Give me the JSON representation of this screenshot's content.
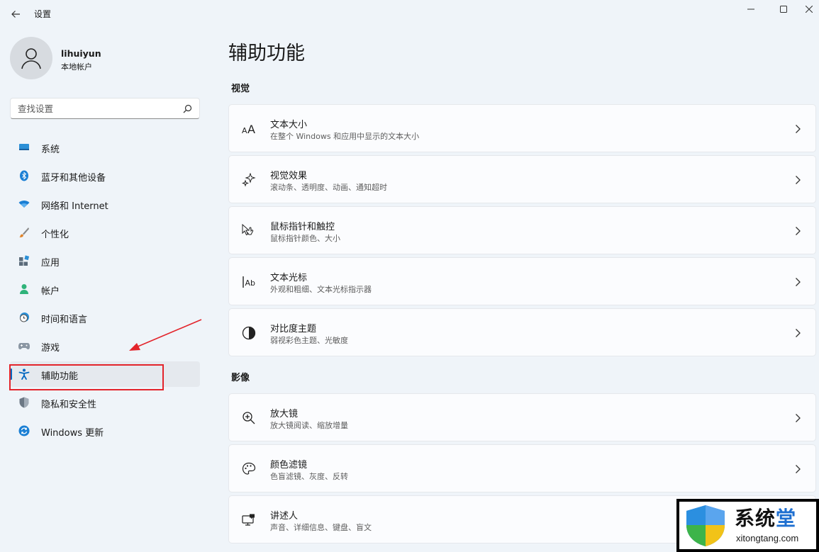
{
  "window": {
    "title": "设置",
    "back_icon": "back-arrow-icon",
    "controls": [
      "minimize-icon",
      "maximize-icon",
      "close-icon"
    ]
  },
  "user": {
    "name": "lihuiyun",
    "account_type": "本地帐户"
  },
  "search": {
    "placeholder": "查找设置",
    "value": ""
  },
  "sidebar": {
    "items": [
      {
        "label": "系统",
        "icon": "system-icon"
      },
      {
        "label": "蓝牙和其他设备",
        "icon": "bluetooth-icon"
      },
      {
        "label": "网络和 Internet",
        "icon": "wifi-icon"
      },
      {
        "label": "个性化",
        "icon": "brush-icon"
      },
      {
        "label": "应用",
        "icon": "apps-icon"
      },
      {
        "label": "帐户",
        "icon": "account-icon"
      },
      {
        "label": "时间和语言",
        "icon": "time-language-icon"
      },
      {
        "label": "游戏",
        "icon": "gamepad-icon"
      },
      {
        "label": "辅助功能",
        "icon": "accessibility-icon",
        "selected": true
      },
      {
        "label": "隐私和安全性",
        "icon": "shield-icon"
      },
      {
        "label": "Windows 更新",
        "icon": "update-icon"
      }
    ]
  },
  "main": {
    "title": "辅助功能",
    "sections": [
      {
        "title": "视觉",
        "cards": [
          {
            "title": "文本大小",
            "subtitle": "在整个 Windows 和应用中显示的文本大小",
            "icon": "text-size-icon"
          },
          {
            "title": "视觉效果",
            "subtitle": "滚动条、透明度、动画、通知超时",
            "icon": "sparkle-icon"
          },
          {
            "title": "鼠标指针和触控",
            "subtitle": "鼠标指针颜色、大小",
            "icon": "pointer-icon"
          },
          {
            "title": "文本光标",
            "subtitle": "外观和粗细、文本光标指示器",
            "icon": "text-cursor-icon"
          },
          {
            "title": "对比度主题",
            "subtitle": "弱视彩色主题、光敏度",
            "icon": "contrast-icon"
          }
        ]
      },
      {
        "title": "影像",
        "cards": [
          {
            "title": "放大镜",
            "subtitle": "放大镜阅读、缩放增量",
            "icon": "magnifier-icon"
          },
          {
            "title": "颜色滤镜",
            "subtitle": "色盲滤镜、灰度、反转",
            "icon": "palette-icon"
          },
          {
            "title": "讲述人",
            "subtitle": "声音、详细信息、键盘、盲文",
            "icon": "narrator-icon"
          }
        ]
      }
    ]
  },
  "watermark": {
    "title_main": "系统",
    "title_accent": "堂",
    "url": "xitongtang.com"
  },
  "colors": {
    "background": "#eff4f9",
    "accent": "#0067c0",
    "annotation_red": "#e3242b",
    "card_bg": "#fbfcfe"
  }
}
